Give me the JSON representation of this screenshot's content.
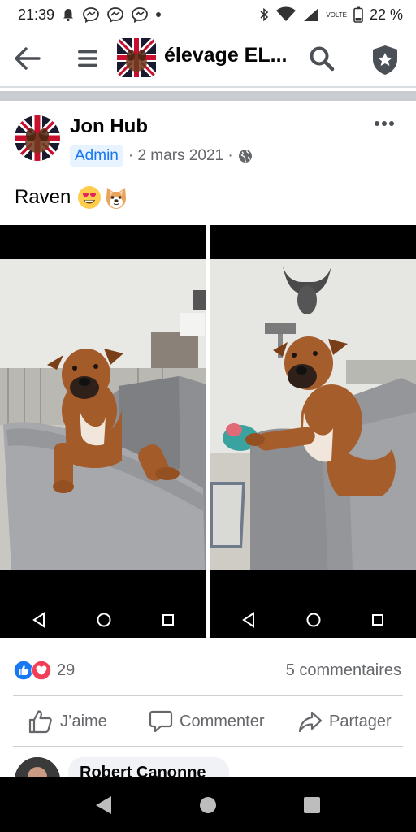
{
  "status_bar": {
    "time": "21:39",
    "battery": "22 %",
    "network_label": "VoLTE"
  },
  "app_bar": {
    "group_title": "élevage EL..."
  },
  "post": {
    "author": "Jon Hub",
    "badge": "Admin",
    "date": "· 2 mars 2021 ·",
    "text": "Raven",
    "emojis": [
      "heart-eyes-emoji",
      "dog-face-emoji"
    ]
  },
  "reactions": {
    "count": "29",
    "comments": "5 commentaires"
  },
  "actions": {
    "like": "J’aime",
    "comment": "Commenter",
    "share": "Partager"
  },
  "comment_preview": {
    "name": "Robert Canonne"
  },
  "icons": [
    "back-arrow-icon",
    "menu-icon",
    "search-icon",
    "shield-star-icon",
    "more-icon",
    "globe-icon",
    "like-icon",
    "love-icon",
    "thumb-icon",
    "comment-icon",
    "share-icon"
  ],
  "colors": {
    "accent": "#1877f2",
    "love": "#f33e58",
    "secondary_text": "#65676b"
  }
}
